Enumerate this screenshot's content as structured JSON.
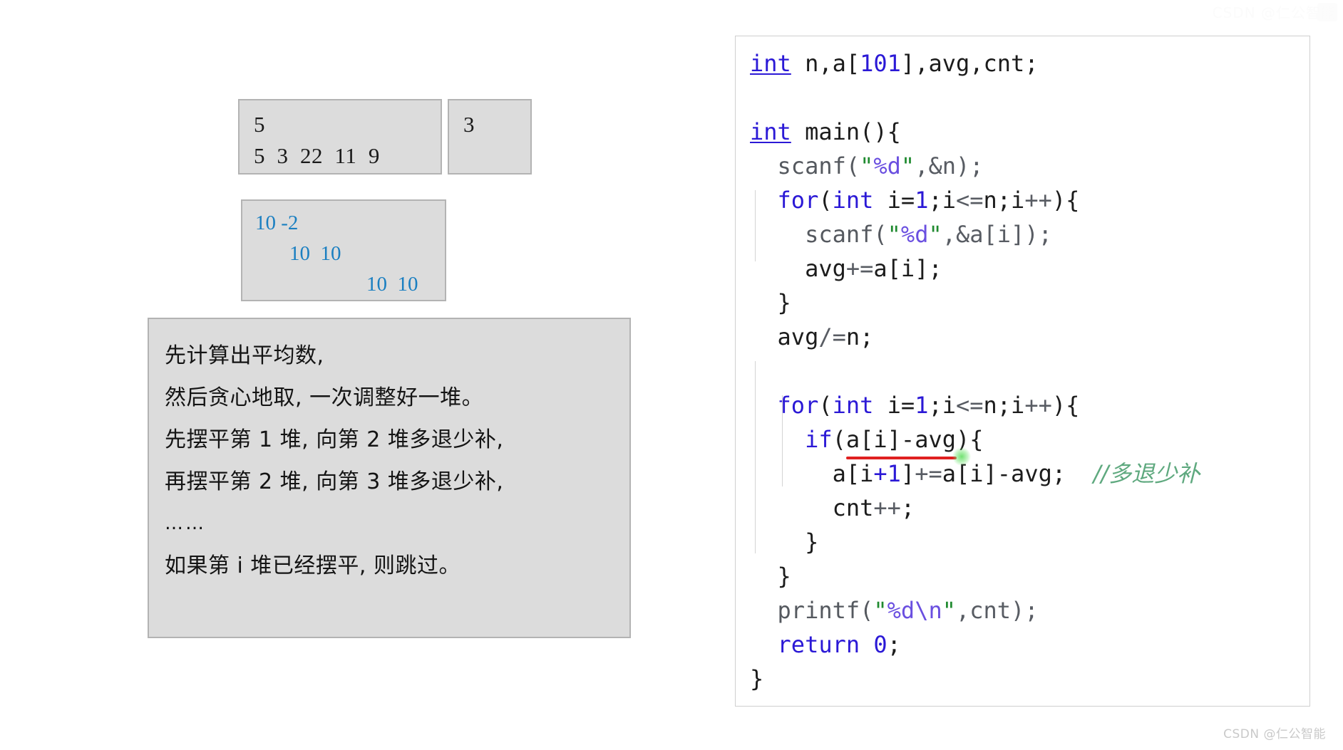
{
  "example_input": {
    "title_lines": [
      "5",
      "5  3  22  11  9"
    ]
  },
  "example_output": {
    "title_lines": [
      "3"
    ]
  },
  "trace": {
    "lines": [
      {
        "text": "10 -2",
        "indent": 0
      },
      {
        "text": "10  10",
        "indent": 1
      },
      {
        "text": "10  10",
        "indent": 2
      }
    ]
  },
  "notes": {
    "lines": [
      "先计算出平均数,",
      "然后贪心地取, 一次调整好一堆。",
      "先摆平第 1 堆, 向第 2 堆多退少补,",
      "再摆平第 2 堆, 向第 3 堆多退少补,",
      "……",
      "如果第 i 堆已经摆平, 则跳过。"
    ],
    "ellipsis_index": 4
  },
  "code": {
    "language": "c",
    "lines": [
      "int n,a[101],avg,cnt;",
      "",
      "int main(){",
      "  scanf(\"%d\",&n);",
      "  for(int i=1;i<=n;i++){",
      "    scanf(\"%d\",&a[i]);",
      "    avg+=a[i];",
      "  }",
      "  avg/=n;",
      "",
      "  for(int i=1;i<=n;i++){",
      "    if(a[i]-avg){",
      "      a[i+1]+=a[i]-avg;  //多退少补",
      "      cnt++;",
      "    }",
      "  }",
      "  printf(\"%d\\n\",cnt);",
      "  return 0;",
      "}"
    ],
    "comment_text": "//多退少补",
    "tokens": {
      "keywords": [
        "int",
        "for",
        "if",
        "return"
      ],
      "functions": [
        "scanf",
        "printf"
      ],
      "numbers": [
        "101",
        "1",
        "0"
      ],
      "strings": [
        "\"%d\"",
        "\"%d\\n\""
      ]
    },
    "colors": {
      "keyword": "#2b19d6",
      "number": "#2b19d6",
      "string_quote": "#1f8a2f",
      "format_spec": "#6a4fe0",
      "comment": "#5fa97f",
      "plain": "#1c1c1c",
      "error_underline": "#e02020",
      "caret_glow": "#5adc5a",
      "panel_border": "#cfcfcf",
      "box_fill": "#dcdcdc",
      "box_border": "#b3b3b3",
      "trace_blue": "#1a7fc1"
    }
  },
  "watermark": {
    "bottom": "CSDN @仁公智能",
    "top": "CSDN @仁公智能"
  }
}
